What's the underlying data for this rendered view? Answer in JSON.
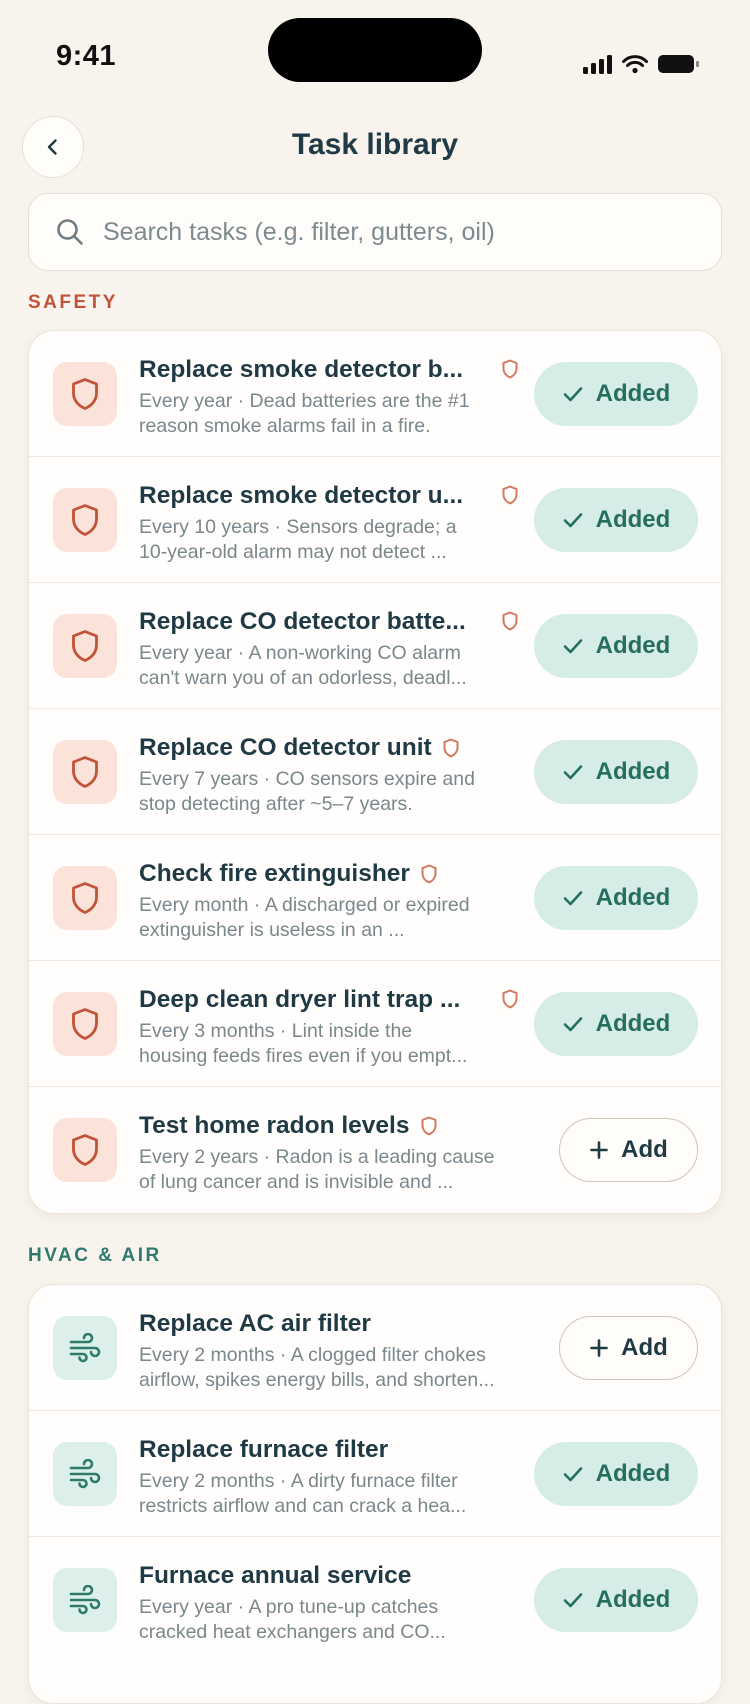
{
  "status_bar": {
    "time": "9:41"
  },
  "header": {
    "title": "Task library",
    "back_icon": "chevron-left-icon"
  },
  "search": {
    "placeholder": "Search tasks (e.g. filter, gutters, oil)",
    "value": ""
  },
  "colors": {
    "background": "#f8f3ed",
    "safety_accent": "#c0533a",
    "hvac_accent": "#2e7a6c",
    "added_bg": "#d6ece7",
    "added_text": "#256e60",
    "title_text": "#1f3a44"
  },
  "sections": [
    {
      "label": "SAFETY",
      "icon": "shield-icon",
      "tasks": [
        {
          "title": "Replace smoke detector b...",
          "desc1": "Every year · Dead batteries are the #1",
          "desc2": "reason smoke alarms fail in a fire.",
          "status": "Added"
        },
        {
          "title": "Replace smoke detector u...",
          "desc1": "Every 10 years · Sensors degrade; a",
          "desc2": "10-year-old alarm may not detect ...",
          "status": "Added"
        },
        {
          "title": "Replace CO detector batte...",
          "desc1": "Every year · A non-working CO alarm",
          "desc2": "can't warn you of an odorless, deadl...",
          "status": "Added"
        },
        {
          "title": "Replace CO detector unit",
          "desc1": "Every 7 years · CO sensors expire and",
          "desc2": "stop detecting after ~5–7 years.",
          "status": "Added"
        },
        {
          "title": "Check fire extinguisher",
          "desc1": "Every month · A discharged or expired",
          "desc2": "extinguisher is useless in an ...",
          "status": "Added"
        },
        {
          "title": "Deep clean dryer lint trap ...",
          "desc1": "Every 3 months · Lint inside the",
          "desc2": "housing feeds fires even if you empt...",
          "status": "Added"
        },
        {
          "title": "Test home radon levels",
          "desc1": "Every 2 years · Radon is a leading cause",
          "desc2": "of lung cancer and is invisible and ...",
          "status": "Add"
        }
      ]
    },
    {
      "label": "HVAC & AIR",
      "icon": "wind-icon",
      "tasks": [
        {
          "title": "Replace AC air filter",
          "desc1": "Every 2 months · A clogged filter chokes",
          "desc2": "airflow, spikes energy bills, and shorten...",
          "status": "Add"
        },
        {
          "title": "Replace furnace filter",
          "desc1": "Every 2 months · A dirty furnace filter",
          "desc2": "restricts airflow and can crack a hea...",
          "status": "Added"
        },
        {
          "title": "Furnace annual service",
          "desc1": "Every year · A pro tune-up catches",
          "desc2": "cracked heat exchangers and CO...",
          "status": "Added"
        }
      ]
    }
  ]
}
